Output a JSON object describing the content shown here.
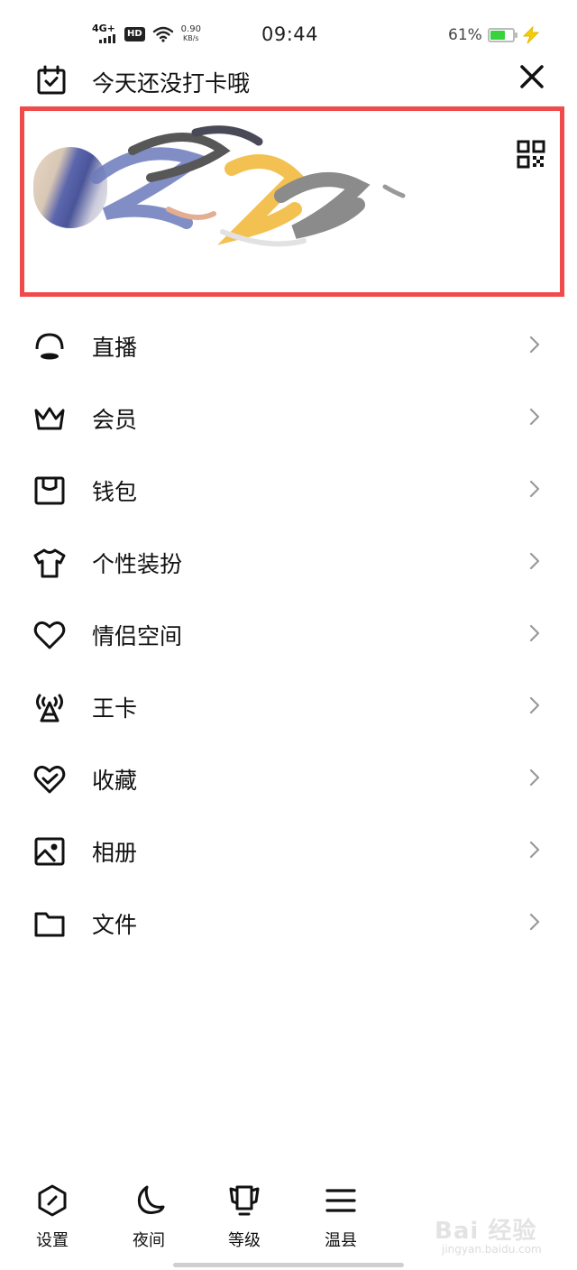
{
  "status_bar": {
    "network": "4G+",
    "hd": "HD",
    "speed_value": "0.90",
    "speed_unit": "KB/s",
    "time": "09:44",
    "battery_percent": "61%",
    "battery_level": 0.61,
    "battery_color": "#37d23c"
  },
  "header": {
    "checkin_text": "今天还没打卡哦",
    "checkin_icon": "calendar-check-icon",
    "close_icon": "close-icon"
  },
  "profile": {
    "qr_icon": "qr-code-icon",
    "highlight_color": "#f04a4a"
  },
  "menu": {
    "items": [
      {
        "label": "直播",
        "icon": "live-icon"
      },
      {
        "label": "会员",
        "icon": "crown-icon"
      },
      {
        "label": "钱包",
        "icon": "wallet-icon"
      },
      {
        "label": "个性装扮",
        "icon": "tshirt-icon"
      },
      {
        "label": "情侣空间",
        "icon": "heart-icon"
      },
      {
        "label": "王卡",
        "icon": "signal-tower-icon"
      },
      {
        "label": "收藏",
        "icon": "favorite-heart-icon"
      },
      {
        "label": "相册",
        "icon": "photo-album-icon"
      },
      {
        "label": "文件",
        "icon": "folder-icon"
      }
    ]
  },
  "bottom_bar": {
    "items": [
      {
        "label": "设置",
        "icon": "settings-icon"
      },
      {
        "label": "夜间",
        "icon": "moon-icon"
      },
      {
        "label": "等级",
        "icon": "trophy-icon"
      },
      {
        "label": "温县",
        "icon": "menu-icon"
      }
    ]
  },
  "watermark": {
    "main": "Bai 经验",
    "sub": "jingyan.baidu.com"
  }
}
